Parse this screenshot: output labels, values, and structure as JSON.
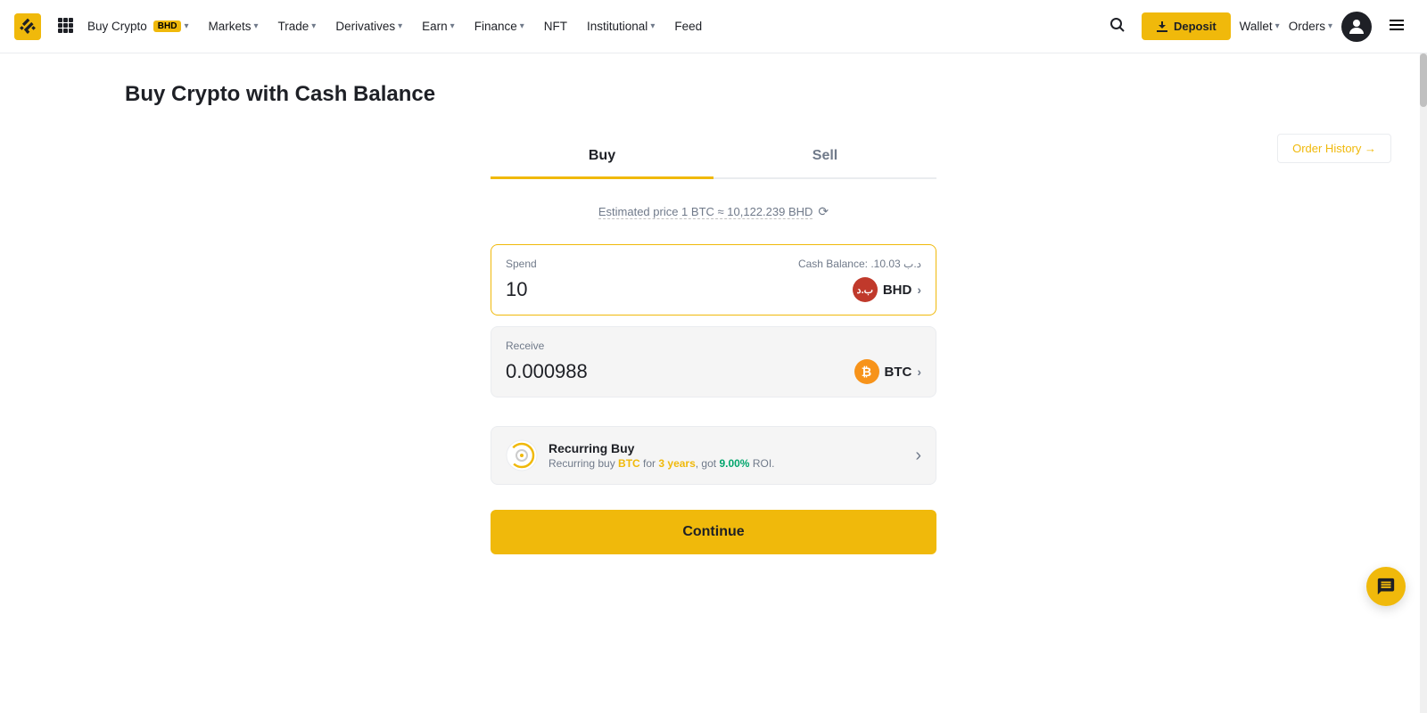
{
  "navbar": {
    "logo_text": "BINANCE",
    "nav_items": [
      {
        "label": "Buy Crypto",
        "badge": "BHD",
        "has_dropdown": true
      },
      {
        "label": "Markets",
        "has_dropdown": true
      },
      {
        "label": "Trade",
        "has_dropdown": true
      },
      {
        "label": "Derivatives",
        "has_dropdown": true
      },
      {
        "label": "Earn",
        "has_dropdown": true
      },
      {
        "label": "Finance",
        "has_dropdown": true
      },
      {
        "label": "NFT",
        "has_dropdown": false
      },
      {
        "label": "Institutional",
        "has_dropdown": true
      },
      {
        "label": "Feed",
        "has_dropdown": false
      }
    ],
    "deposit_label": "Deposit",
    "wallet_label": "Wallet",
    "orders_label": "Orders"
  },
  "page": {
    "title": "Buy Crypto with Cash Balance",
    "order_history_label": "Order History →"
  },
  "tabs": [
    {
      "label": "Buy",
      "active": true
    },
    {
      "label": "Sell",
      "active": false
    }
  ],
  "estimated_price": {
    "text": "Estimated price 1 BTC ≈ 10,122.239 BHD"
  },
  "spend_card": {
    "label": "Spend",
    "balance_label": "Cash Balance: .10.03 د.ب",
    "amount": "10",
    "currency_code": "BHD",
    "currency_symbol": "ب.د"
  },
  "receive_card": {
    "label": "Receive",
    "amount": "0.000988",
    "currency_code": "BTC",
    "currency_symbol": "₿"
  },
  "recurring_buy": {
    "title": "Recurring Buy",
    "desc_prefix": "Recurring buy ",
    "crypto": "BTC",
    "desc_middle": " for ",
    "duration": "3 years",
    "desc_suffix": ", got ",
    "roi": "9.00%",
    "desc_end": " ROI."
  },
  "continue_button": {
    "label": "Continue"
  },
  "chat": {
    "icon_label": "chat-icon"
  }
}
